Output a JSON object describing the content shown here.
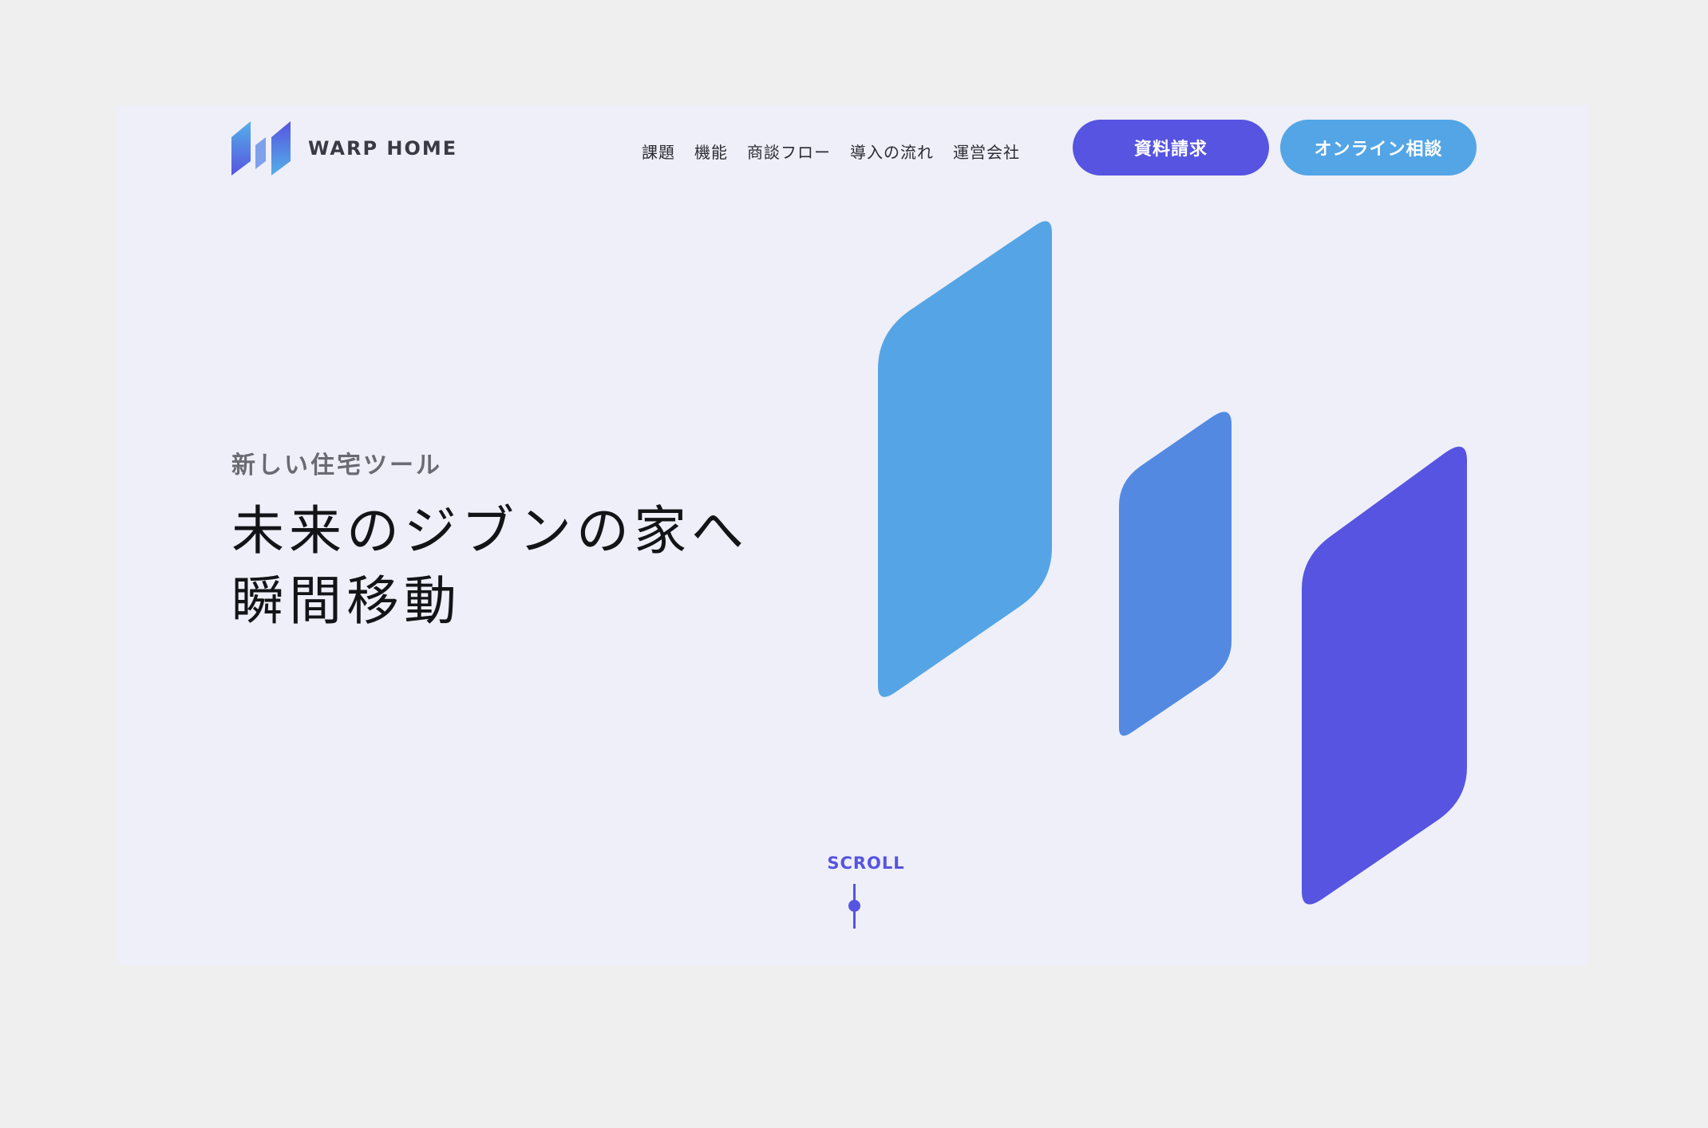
{
  "header": {
    "logo_text": "WARP HOME",
    "nav": [
      "課題",
      "機能",
      "商談フロー",
      "導入の流れ",
      "運営会社"
    ],
    "cta_primary": "資料請求",
    "cta_secondary": "オンライン相談"
  },
  "hero": {
    "subtitle": "新しい住宅ツール",
    "title_line1": "未来のジブンの家へ",
    "title_line2": "瞬間移動"
  },
  "scroll": {
    "label": "SCROLL"
  },
  "colors": {
    "page_background": "#efeff0",
    "section_background": "#eeeff8",
    "primary": "#5654e0",
    "secondary": "#53a5e6",
    "shape_light": "#55a5e6",
    "shape_mid": "#5389e1",
    "shape_dark": "#5654e0"
  },
  "icons": {
    "logo": "warp-home-logo-icon"
  }
}
